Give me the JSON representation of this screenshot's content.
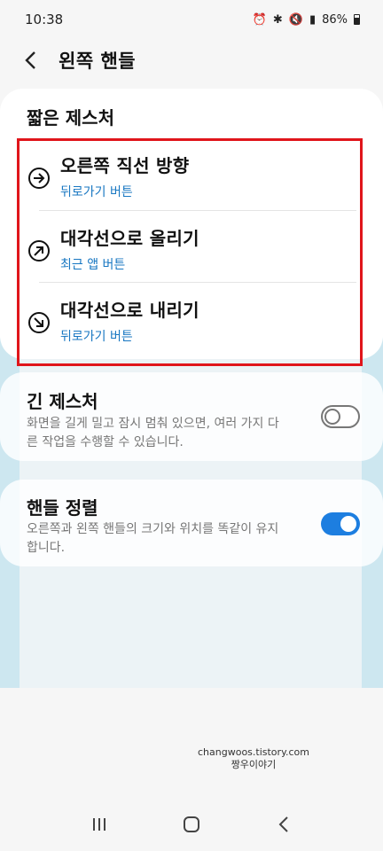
{
  "status_bar": {
    "time": "10:38",
    "battery": "86%"
  },
  "header": {
    "title": "왼쪽 핸들"
  },
  "short_gesture": {
    "title": "짧은 제스처",
    "options": [
      {
        "title": "오른쪽 직선 방향",
        "action": "뒤로가기 버튼",
        "icon": "arrow-right-icon"
      },
      {
        "title": "대각선으로 올리기",
        "action": "최근 앱 버튼",
        "icon": "arrow-up-right-icon"
      },
      {
        "title": "대각선으로 내리기",
        "action": "뒤로가기 버튼",
        "icon": "arrow-down-right-icon"
      }
    ]
  },
  "long_gesture": {
    "title": "긴 제스처",
    "description": "화면을 길게 밀고 잠시 멈춰 있으면, 여러 가지 다른 작업을 수행할 수 있습니다.",
    "enabled": false
  },
  "handle_align": {
    "title": "핸들 정렬",
    "description": "오른쪽과 왼쪽 핸들의 크기와 위치를 똑같이 유지합니다.",
    "enabled": true
  },
  "watermark": {
    "line1": "changwoos.tistory.com",
    "line2": "짱우이야기"
  },
  "colors": {
    "accent": "#1d7ee0",
    "link": "#1877c2",
    "highlight": "#e0151b"
  }
}
